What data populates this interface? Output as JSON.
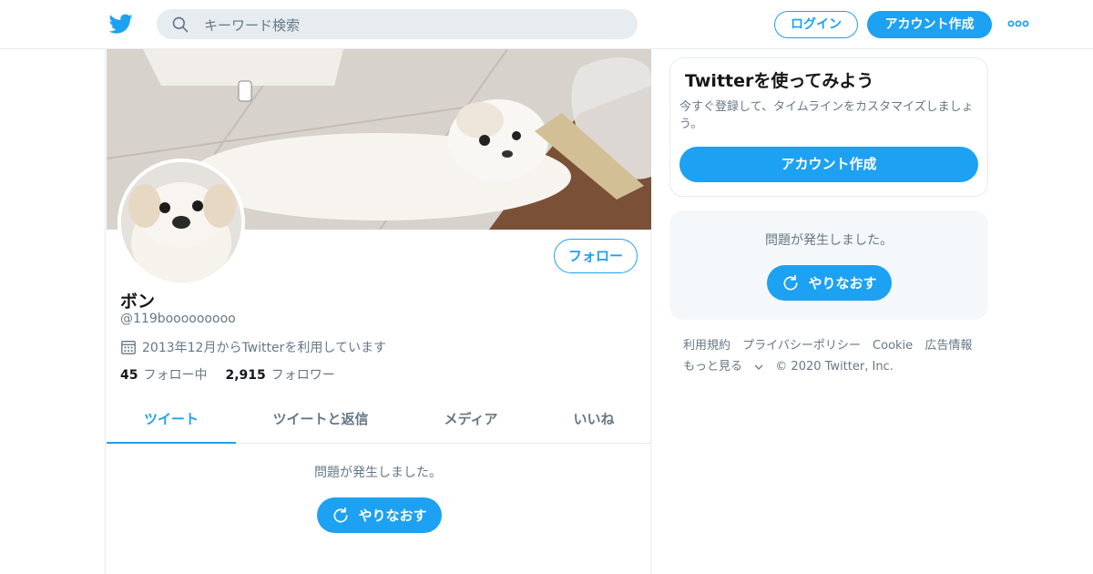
{
  "header": {
    "logo": "twitter-bird-icon",
    "search_placeholder": "キーワード検索",
    "login_label": "ログイン",
    "signup_label": "アカウント作成",
    "more_icon": "more-dots-icon"
  },
  "profile": {
    "name": "ボン",
    "handle": "@119booooooooo",
    "joined": "2013年12月からTwitterを利用しています",
    "follow_label": "フォロー",
    "following_count": "45",
    "following_label": "フォロー中",
    "followers_count": "2,915",
    "followers_label": "フォロワー"
  },
  "tabs": [
    {
      "label": "ツイート",
      "active": true
    },
    {
      "label": "ツイートと返信",
      "active": false
    },
    {
      "label": "メディア",
      "active": false
    },
    {
      "label": "いいね",
      "active": false
    }
  ],
  "timeline": {
    "error_text": "問題が発生しました。",
    "retry_label": "やりなおす"
  },
  "sidebar": {
    "signup_card": {
      "title": "Twitterを使ってみよう",
      "description": "今すぐ登録して、タイムラインをカスタマイズしましょう。",
      "button_label": "アカウント作成"
    },
    "error_card": {
      "text": "問題が発生しました。",
      "retry_label": "やりなおす"
    },
    "footer": {
      "links": [
        "利用規約",
        "プライバシーポリシー",
        "Cookie",
        "広告情報"
      ],
      "more_label": "もっと見る",
      "copyright": "© 2020 Twitter, Inc."
    }
  },
  "colors": {
    "accent": "#1da1f2",
    "secondary_text": "#657786",
    "border": "#e6ecf0"
  }
}
